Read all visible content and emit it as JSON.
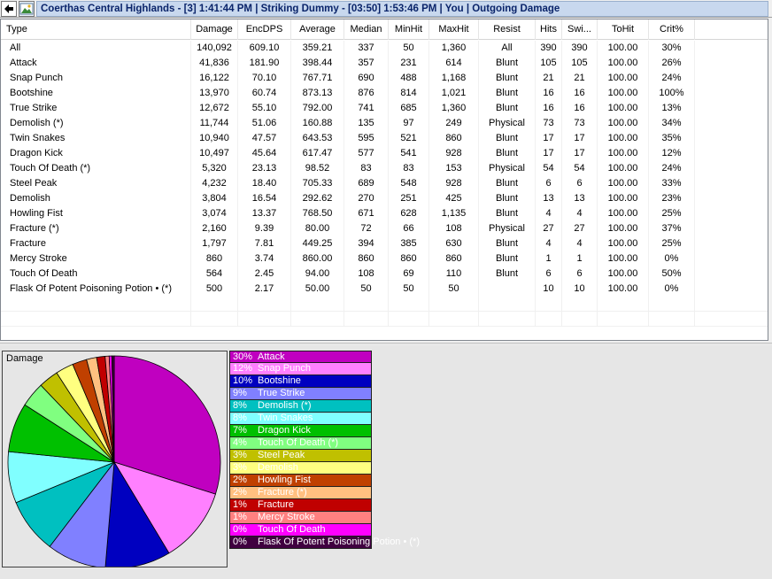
{
  "header": {
    "title": "Coerthas Central Highlands - [3] 1:41:44 PM | Striking Dummy - [03:50] 1:53:46 PM | You | Outgoing Damage"
  },
  "table": {
    "columns": [
      "Type",
      "Damage",
      "EncDPS",
      "Average",
      "Median",
      "MinHit",
      "MaxHit",
      "Resist",
      "Hits",
      "Swi...",
      "ToHit",
      "Crit%"
    ],
    "rows": [
      [
        "All",
        "140,092",
        "609.10",
        "359.21",
        "337",
        "50",
        "1,360",
        "All",
        "390",
        "390",
        "100.00",
        "30%"
      ],
      [
        "Attack",
        "41,836",
        "181.90",
        "398.44",
        "357",
        "231",
        "614",
        "Blunt",
        "105",
        "105",
        "100.00",
        "26%"
      ],
      [
        "Snap Punch",
        "16,122",
        "70.10",
        "767.71",
        "690",
        "488",
        "1,168",
        "Blunt",
        "21",
        "21",
        "100.00",
        "24%"
      ],
      [
        "Bootshine",
        "13,970",
        "60.74",
        "873.13",
        "876",
        "814",
        "1,021",
        "Blunt",
        "16",
        "16",
        "100.00",
        "100%"
      ],
      [
        "True Strike",
        "12,672",
        "55.10",
        "792.00",
        "741",
        "685",
        "1,360",
        "Blunt",
        "16",
        "16",
        "100.00",
        "13%"
      ],
      [
        "Demolish (*)",
        "11,744",
        "51.06",
        "160.88",
        "135",
        "97",
        "249",
        "Physical",
        "73",
        "73",
        "100.00",
        "34%"
      ],
      [
        "Twin Snakes",
        "10,940",
        "47.57",
        "643.53",
        "595",
        "521",
        "860",
        "Blunt",
        "17",
        "17",
        "100.00",
        "35%"
      ],
      [
        "Dragon Kick",
        "10,497",
        "45.64",
        "617.47",
        "577",
        "541",
        "928",
        "Blunt",
        "17",
        "17",
        "100.00",
        "12%"
      ],
      [
        "Touch Of Death (*)",
        "5,320",
        "23.13",
        "98.52",
        "83",
        "83",
        "153",
        "Physical",
        "54",
        "54",
        "100.00",
        "24%"
      ],
      [
        "Steel Peak",
        "4,232",
        "18.40",
        "705.33",
        "689",
        "548",
        "928",
        "Blunt",
        "6",
        "6",
        "100.00",
        "33%"
      ],
      [
        "Demolish",
        "3,804",
        "16.54",
        "292.62",
        "270",
        "251",
        "425",
        "Blunt",
        "13",
        "13",
        "100.00",
        "23%"
      ],
      [
        "Howling Fist",
        "3,074",
        "13.37",
        "768.50",
        "671",
        "628",
        "1,135",
        "Blunt",
        "4",
        "4",
        "100.00",
        "25%"
      ],
      [
        "Fracture (*)",
        "2,160",
        "9.39",
        "80.00",
        "72",
        "66",
        "108",
        "Physical",
        "27",
        "27",
        "100.00",
        "37%"
      ],
      [
        "Fracture",
        "1,797",
        "7.81",
        "449.25",
        "394",
        "385",
        "630",
        "Blunt",
        "4",
        "4",
        "100.00",
        "25%"
      ],
      [
        "Mercy Stroke",
        "860",
        "3.74",
        "860.00",
        "860",
        "860",
        "860",
        "Blunt",
        "1",
        "1",
        "100.00",
        "0%"
      ],
      [
        "Touch Of Death",
        "564",
        "2.45",
        "94.00",
        "108",
        "69",
        "110",
        "Blunt",
        "6",
        "6",
        "100.00",
        "50%"
      ],
      [
        "Flask Of Potent Poisoning Potion • (*)",
        "500",
        "2.17",
        "50.00",
        "50",
        "50",
        "50",
        "",
        "10",
        "10",
        "100.00",
        "0%"
      ]
    ]
  },
  "chart_data": {
    "type": "pie",
    "title": "Damage",
    "slices": [
      {
        "label": "Attack",
        "pct": "30%",
        "value": 41836,
        "color": "#c000c0",
        "text_color": "#ffffff"
      },
      {
        "label": "Snap Punch",
        "pct": "12%",
        "value": 16122,
        "color": "#ff80ff",
        "text_color": "#ffffff"
      },
      {
        "label": "Bootshine",
        "pct": "10%",
        "value": 13970,
        "color": "#0000c0",
        "text_color": "#ffffff"
      },
      {
        "label": "True Strike",
        "pct": "9%",
        "value": 12672,
        "color": "#8080ff",
        "text_color": "#ffffff"
      },
      {
        "label": "Demolish (*)",
        "pct": "8%",
        "value": 11744,
        "color": "#00c0c0",
        "text_color": "#ffffff"
      },
      {
        "label": "Twin Snakes",
        "pct": "8%",
        "value": 10940,
        "color": "#80ffff",
        "text_color": "#ffffff"
      },
      {
        "label": "Dragon Kick",
        "pct": "7%",
        "value": 10497,
        "color": "#00c000",
        "text_color": "#ffffff"
      },
      {
        "label": "Touch Of Death (*)",
        "pct": "4%",
        "value": 5320,
        "color": "#80ff80",
        "text_color": "#ffffff"
      },
      {
        "label": "Steel Peak",
        "pct": "3%",
        "value": 4232,
        "color": "#c0c000",
        "text_color": "#ffffff"
      },
      {
        "label": "Demolish",
        "pct": "3%",
        "value": 3804,
        "color": "#ffff80",
        "text_color": "#ffffff"
      },
      {
        "label": "Howling Fist",
        "pct": "2%",
        "value": 3074,
        "color": "#c04000",
        "text_color": "#ffffff"
      },
      {
        "label": "Fracture (*)",
        "pct": "2%",
        "value": 2160,
        "color": "#ffc080",
        "text_color": "#ffffff"
      },
      {
        "label": "Fracture",
        "pct": "1%",
        "value": 1797,
        "color": "#c00000",
        "text_color": "#ffffff"
      },
      {
        "label": "Mercy Stroke",
        "pct": "1%",
        "value": 860,
        "color": "#ff8080",
        "text_color": "#ffffff"
      },
      {
        "label": "Touch Of Death",
        "pct": "0%",
        "value": 564,
        "color": "#ff00ff",
        "text_color": "#ffffff"
      },
      {
        "label": "Flask Of Potent Poisoning Potion • (*)",
        "pct": "0%",
        "value": 500,
        "color": "#400040",
        "text_color": "#ffffff"
      }
    ]
  }
}
